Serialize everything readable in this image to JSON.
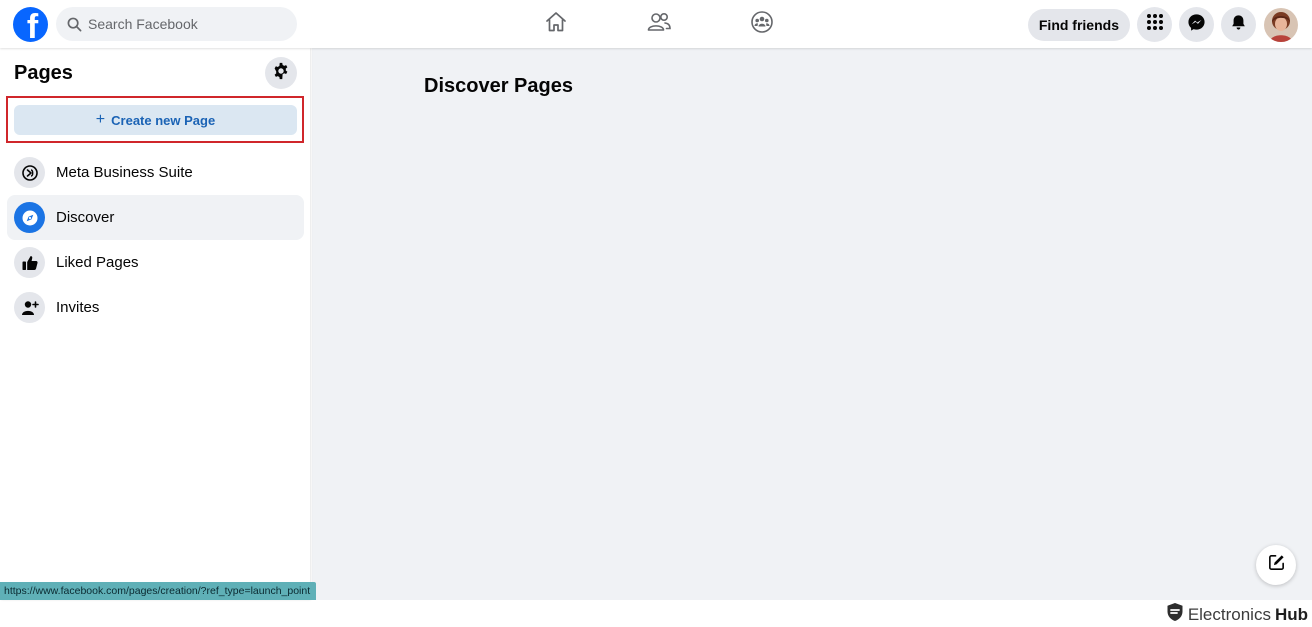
{
  "topbar": {
    "logo_letter": "f",
    "search_placeholder": "Search Facebook",
    "find_friends_label": "Find friends"
  },
  "sidebar": {
    "title": "Pages",
    "create_button_label": "Create new Page",
    "create_button_symbol": "+",
    "items": [
      {
        "label": "Meta Business Suite",
        "icon": "meta-business-suite-icon",
        "active": false
      },
      {
        "label": "Discover",
        "icon": "compass-icon",
        "active": true
      },
      {
        "label": "Liked Pages",
        "icon": "thumbs-up-icon",
        "active": false
      },
      {
        "label": "Invites",
        "icon": "person-add-icon",
        "active": false
      }
    ]
  },
  "main": {
    "title": "Discover Pages"
  },
  "status_bar": {
    "url": "https://www.facebook.com/pages/creation/?ref_type=launch_point"
  },
  "watermark": {
    "text_light": "Electronics",
    "text_bold": "Hub"
  },
  "colors": {
    "brand_blue": "#0866ff",
    "highlight_red": "#d0262b",
    "create_button_bg": "#dbe7f2",
    "create_button_text": "#1b63b5",
    "main_background": "#f0f2f5"
  }
}
